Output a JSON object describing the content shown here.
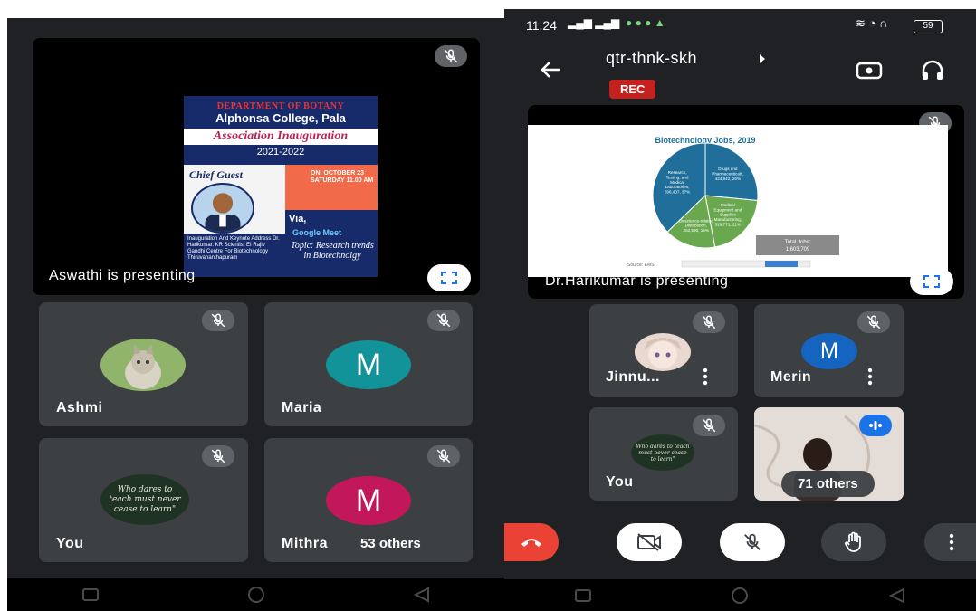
{
  "left": {
    "presenter_label": "Aswathi is presenting",
    "poster": {
      "dept": "DEPARTMENT OF BOTANY",
      "college": "Alphonsa College, Pala",
      "event": "Association Inauguration",
      "year": "2021-2022",
      "chief_guest": "Chief Guest",
      "date": "ON, OCTOBER 23 SATURDAY 11.00 AM",
      "via": "Via,",
      "platform": "Google Meet",
      "guest_info": "Inauguration And Keynote Address Dr. Harikumar. KR Scientist EI Rajiv Gandhi Centre For Biotechnology Thiruvananthapuram",
      "topic": "Topic: Research trends in Biotechnolgy"
    },
    "participants": [
      {
        "name": "Ashmi"
      },
      {
        "name": "Maria",
        "initial": "M"
      },
      {
        "name": "You",
        "board": "Who dares to teach must never cease to learn\""
      },
      {
        "name": "Mithra",
        "initial": "M"
      }
    ],
    "others": "53 others"
  },
  "right": {
    "status_time": "11:24",
    "battery": "59",
    "meeting_code": "qtr-thnk-skh",
    "rec_label": "REC",
    "presenter_label": "Dr.Harikumar is presenting",
    "participants": [
      {
        "name": "Jinnu..."
      },
      {
        "name": "Merin",
        "initial": "M"
      },
      {
        "name": "You",
        "board": "Who dares to teach must never cease to learn\""
      }
    ],
    "others": "71 others"
  },
  "chart_data": {
    "type": "pie",
    "title": "Biotechnology Jobs, 2019",
    "slices": [
      {
        "label": "Research, Testing, and Medical Laboratories",
        "text": "Research, Testing, and Medical Laboratories, 596,407, 37%",
        "value": 596407,
        "percent": 37
      },
      {
        "label": "Drugs and Pharmaceuticals",
        "text": "Drugs and Pharmaceuticals, 424,942, 26%",
        "value": 424942,
        "percent": 26
      },
      {
        "label": "Medical Equipment and Supplies Manufacturing",
        "text": "Medical Equipment and Supplies Manufacturing, 329,771, 21%",
        "value": 329771,
        "percent": 21
      },
      {
        "label": "Bioscience-related Distribution",
        "text": "Bioscience-related Distribution, 252,590, 16%",
        "value": 252590,
        "percent": 16
      }
    ],
    "total_label": "Total Jobs: 1,603,709",
    "source_label": "Source: EMSI"
  },
  "colors": {
    "bg": "#202124",
    "tile": "#3c4043",
    "end_call": "#ea4335",
    "maria": "#12939a",
    "mithra": "#c2185b",
    "merin": "#1565c0",
    "pie_blue": "#1f6f9a",
    "pie_green": "#6aa84f"
  }
}
